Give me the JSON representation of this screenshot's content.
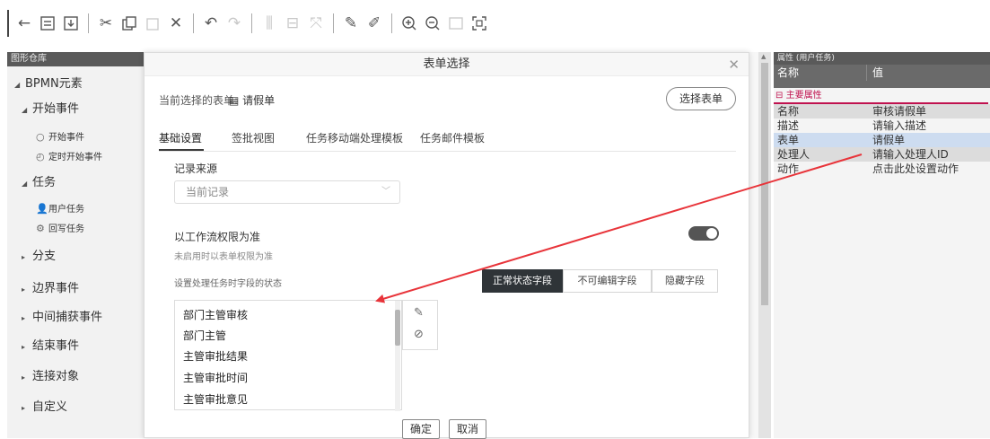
{
  "palette": {
    "title": "图形仓库",
    "root": "BPMN元素",
    "groups": [
      {
        "label": "开始事件"
      },
      {
        "label": "任务"
      },
      {
        "label": "分支"
      },
      {
        "label": "边界事件"
      },
      {
        "label": "中间捕获事件"
      },
      {
        "label": "结束事件"
      },
      {
        "label": "连接对象"
      },
      {
        "label": "自定义"
      }
    ],
    "leaves": [
      {
        "label": "开始事件",
        "icon": "circle-icon"
      },
      {
        "label": "定时开始事件",
        "icon": "timer-circle-icon"
      },
      {
        "label": "用户任务",
        "icon": "user-icon"
      },
      {
        "label": "回写任务",
        "icon": "gear-icon"
      }
    ]
  },
  "dialog": {
    "title": "表单选择",
    "current_form_label": "当前选择的表单:",
    "current_form_value": "请假单",
    "choose_button": "选择表单",
    "tabs": [
      "基础设置",
      "签批视图",
      "任务移动端处理模板",
      "任务邮件模板"
    ],
    "record_source_label": "记录来源",
    "record_source_value": "当前记录",
    "workflow_permission_label": "以工作流权限为准",
    "workflow_permission_hint": "未启用时以表单权限为准",
    "field_state_label": "设置处理任务时字段的状态",
    "segments": [
      "正常状态字段",
      "不可编辑字段",
      "隐藏字段"
    ],
    "fields": [
      "部门主管审核",
      "部门主管",
      "主管审批结果",
      "主管审批时间",
      "主管审批意见"
    ],
    "ok": "确定",
    "cancel": "取消"
  },
  "properties": {
    "title": "属性 (用户任务)",
    "col_name": "名称",
    "col_value": "值",
    "section": "主要属性",
    "rows": [
      {
        "k": "名称",
        "v": "审核请假单"
      },
      {
        "k": "描述",
        "v": "请输入描述"
      },
      {
        "k": "表单",
        "v": "请假单"
      },
      {
        "k": "处理人",
        "v": "请输入处理人ID"
      },
      {
        "k": "动作",
        "v": "点击此处设置动作"
      }
    ]
  },
  "colors": {
    "annotation_arrow": "#e8343a",
    "section_accent": "#c0124f",
    "toggle_on": "#555555"
  }
}
